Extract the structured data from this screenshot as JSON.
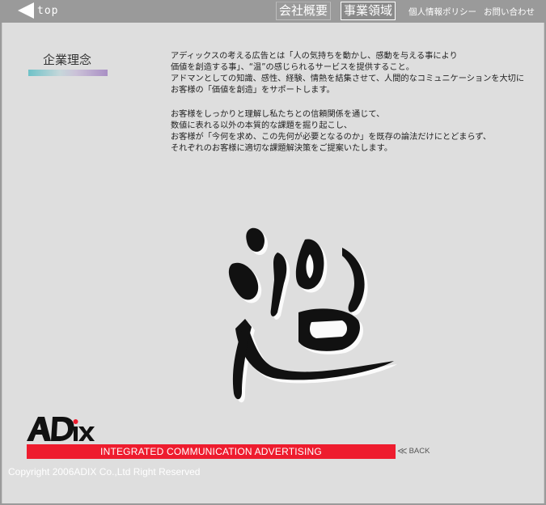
{
  "nav": {
    "top_label": "top",
    "main_items": [
      {
        "label": "会社概要",
        "active": false
      },
      {
        "label": "事業領域",
        "active": true
      }
    ],
    "sub_items": [
      "個人情報ポリシー",
      "お問い合わせ"
    ]
  },
  "content": {
    "section_title": "企業理念",
    "paragraph1": [
      "アディックスの考える広告とは「人の気持ちを動かし、感動を与える事により",
      "価値を創造する事」、“温”の感じられるサービスを提供すること。",
      "アドマンとしての知識、感性、経験、情熱を結集させて、人間的なコミュニケーションを大切に",
      "お客様の「価値を創造」をサポートします。"
    ],
    "paragraph2": [
      "お客様をしっかりと理解し私たちとの信頼関係を通じて、",
      "数値に表れる以外の本質的な課題を掘り起こし、",
      "お客様が「今何を求め、この先何が必要となるのか」を既存の論法だけにとどまらず、",
      "それぞれのお客様に適切な課題解決策をご提案いたします。"
    ]
  },
  "footer": {
    "logo_text": "ADiX",
    "band_text": "INTEGRATED COMMUNICATION ADVERTISING",
    "back_label": "BACK",
    "copyright": "Copyright 2006ADIX Co.,Ltd Right Reserved"
  },
  "colors": {
    "band_red": "#ee1c2e",
    "panel_bg": "#dedede",
    "frame_gray": "#9a9a9a"
  },
  "icons": [
    "back-arrow-icon",
    "chevron-left-icon",
    "calligraphy-on-icon"
  ]
}
